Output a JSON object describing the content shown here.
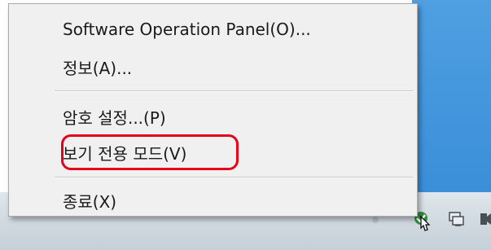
{
  "menu": {
    "items": [
      {
        "label": "Software Operation Panel(O)..."
      },
      {
        "label": "정보(A)..."
      },
      {
        "label": "암호 설정...(P)"
      },
      {
        "label": "보기 전용 모드(V)"
      },
      {
        "label": "종료(X)"
      }
    ],
    "highlighted_item": "보기 전용 모드(V)",
    "highlight_color": "#e2001a"
  },
  "tray": {
    "icons": [
      "scanner-status-icon",
      "network-icon",
      "system-tray-icon"
    ]
  },
  "colors": {
    "desktop": "#3a8fd8",
    "taskbar": "#cfd8df",
    "menu_background": "#f0f0f0"
  }
}
